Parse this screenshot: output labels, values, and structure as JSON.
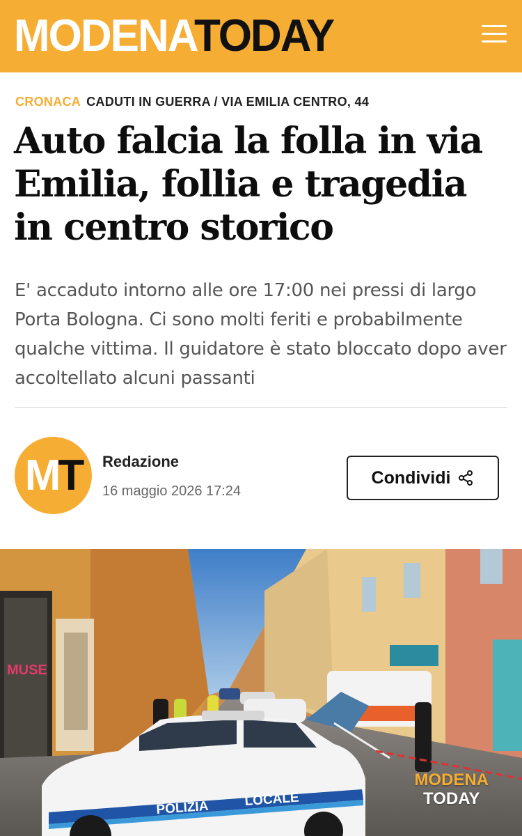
{
  "header": {
    "logo_part1": "MODENA",
    "logo_part2": "TODAY",
    "menu_icon": "hamburger-menu-icon",
    "color": "#f6ad33"
  },
  "article": {
    "category": "CRONACA",
    "tags": "CADUTI IN GUERRA / VIA EMILIA CENTRO, 44",
    "title": "Auto falcia la folla in via Emilia, follia e tragedia in centro storico",
    "summary": "E' accaduto intorno alle ore 17:00 nei pressi di largo Porta Bologna. Ci sono molti feriti e probabilmente qualche vittima. Il guidatore è stato bloccato dopo aver accoltellato alcuni passanti"
  },
  "byline": {
    "avatar_m": "M",
    "avatar_t": "T",
    "author": "Redazione",
    "date": "16 maggio 2026 17:24",
    "share_label": "Condividi",
    "share_icon": "share-icon"
  },
  "photo": {
    "car_text1": "POLIZIA",
    "car_text2": "LOCALE",
    "shop_sign": "MUSE",
    "watermark_line1": "MODENA",
    "watermark_line2": "TODAY"
  }
}
